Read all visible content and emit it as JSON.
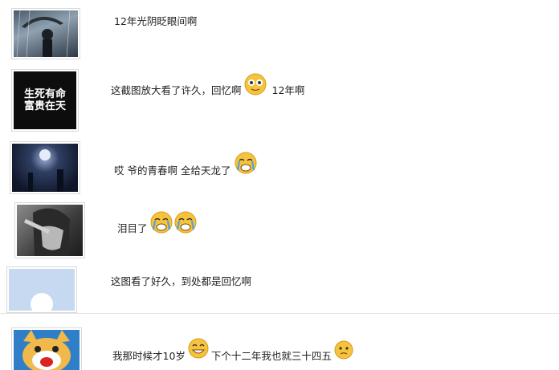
{
  "comments": [
    {
      "text": "12年光阴眨眼间啊"
    },
    {
      "text_a": "这截图放大看了许久，回忆啊",
      "text_b": "12年啊"
    },
    {
      "text": "哎 爷的青春啊 全给天龙了"
    },
    {
      "text": "泪目了"
    },
    {
      "text": "这图看了好久，到处都是回忆啊"
    },
    {
      "text_a": "我那时候才10岁",
      "text_b": "下个十二年我也就三十四五"
    }
  ],
  "avatar_text": {
    "line1": "生死有命",
    "line2": "富贵在天"
  },
  "icons": [
    "smile-icon",
    "cry-icon",
    "cry-icon",
    "cry-icon",
    "grin-icon",
    "worried-icon"
  ],
  "colors": {
    "text": "#222222",
    "border": "#d9d9d9",
    "emoji_yellow": "#f6c33d",
    "tear_blue": "#4fa3e0"
  }
}
